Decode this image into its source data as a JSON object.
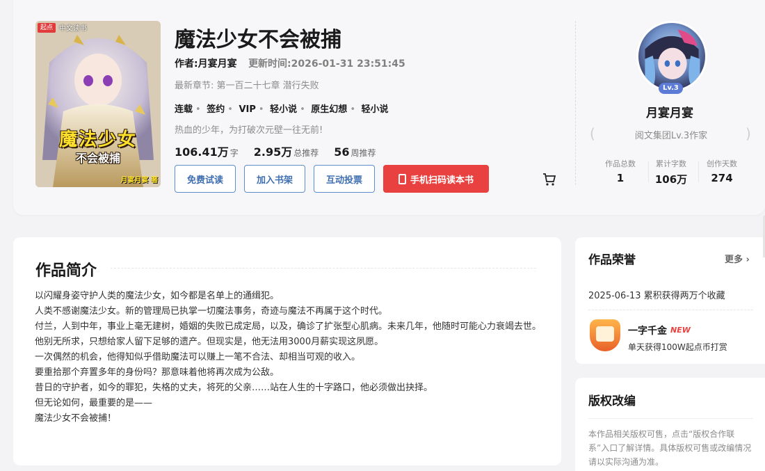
{
  "cover": {
    "badge": "起点",
    "badge_label": "中文读书",
    "title": "魔法少女",
    "subtitle": "不会被捕",
    "author_mark": "月宴月宴 著"
  },
  "book": {
    "title": "魔法少女不会被捕",
    "author": "作者:月宴月宴",
    "update_time": "更新时间:2026-01-31 23:51:45",
    "latest_chapter": "最新章节: 第一百二十七章 潜行失败",
    "tags": [
      "连载",
      "签约",
      "VIP",
      "轻小说",
      "原生幻想",
      "轻小说"
    ],
    "slogan": "热血的少年，为打破次元壁一往无前!",
    "stats": [
      {
        "num": "106.41万",
        "unit": "字"
      },
      {
        "num": "2.95万",
        "unit": "总推荐"
      },
      {
        "num": "56",
        "unit": "周推荐"
      }
    ]
  },
  "actions": {
    "trial": "免费试读",
    "shelf": "加入书架",
    "vote": "互动投票",
    "scan": "手机扫码读本书"
  },
  "author_panel": {
    "level": "Lv.3",
    "name": "月宴月宴",
    "org": "阅文集团Lv.3作家",
    "stats": [
      {
        "label": "作品总数",
        "value": "1"
      },
      {
        "label": "累计字数",
        "value": "106万"
      },
      {
        "label": "创作天数",
        "value": "274"
      }
    ]
  },
  "intro": {
    "title": "作品简介",
    "paragraphs": [
      "以闪耀身姿守护人类的魔法少女，如今都是名单上的通缉犯。",
      "人类不感谢魔法少女。新的管理局已执掌一切魔法事务，奇迹与魔法不再属于这个时代。",
      "付兰，人到中年，事业上毫无建树，婚姻的失败已成定局，以及，确诊了扩张型心肌病。未来几年，他随时可能心力衰竭去世。",
      "他别无所求，只想给家人留下足够的遗产。但现实是，他无法用3000月薪实现这夙愿。",
      "一次偶然的机会，他得知似乎借助魔法可以赚上一笔不合法、却相当可观的收入。",
      "要重拾那个弃置多年的身份吗？那意味着他将再次成为公敌。",
      "昔日的守护者，如今的罪犯，失格的丈夫，将死的父亲……站在人生的十字路口，他必须做出抉择。",
      "但无论如何，最重要的是——",
      "魔法少女不会被捕！"
    ]
  },
  "honors": {
    "title": "作品荣誉",
    "more": "更多 ›",
    "entry_date": "2025-06-13 累积获得两万个收藏",
    "badge_name": "一字千金",
    "badge_new": "NEW",
    "badge_desc": "单天获得100W起点币打赏"
  },
  "copyright": {
    "title": "版权改编",
    "body": "本作品相关版权可售，点击“版权合作联系”入口了解详情。具体版权可售或改编情况请以实际沟通为准。"
  },
  "colors": {
    "accent_blue": "#3f6fb0",
    "accent_red": "#e8413f",
    "cover_title_yellow": "#ffe12c"
  }
}
